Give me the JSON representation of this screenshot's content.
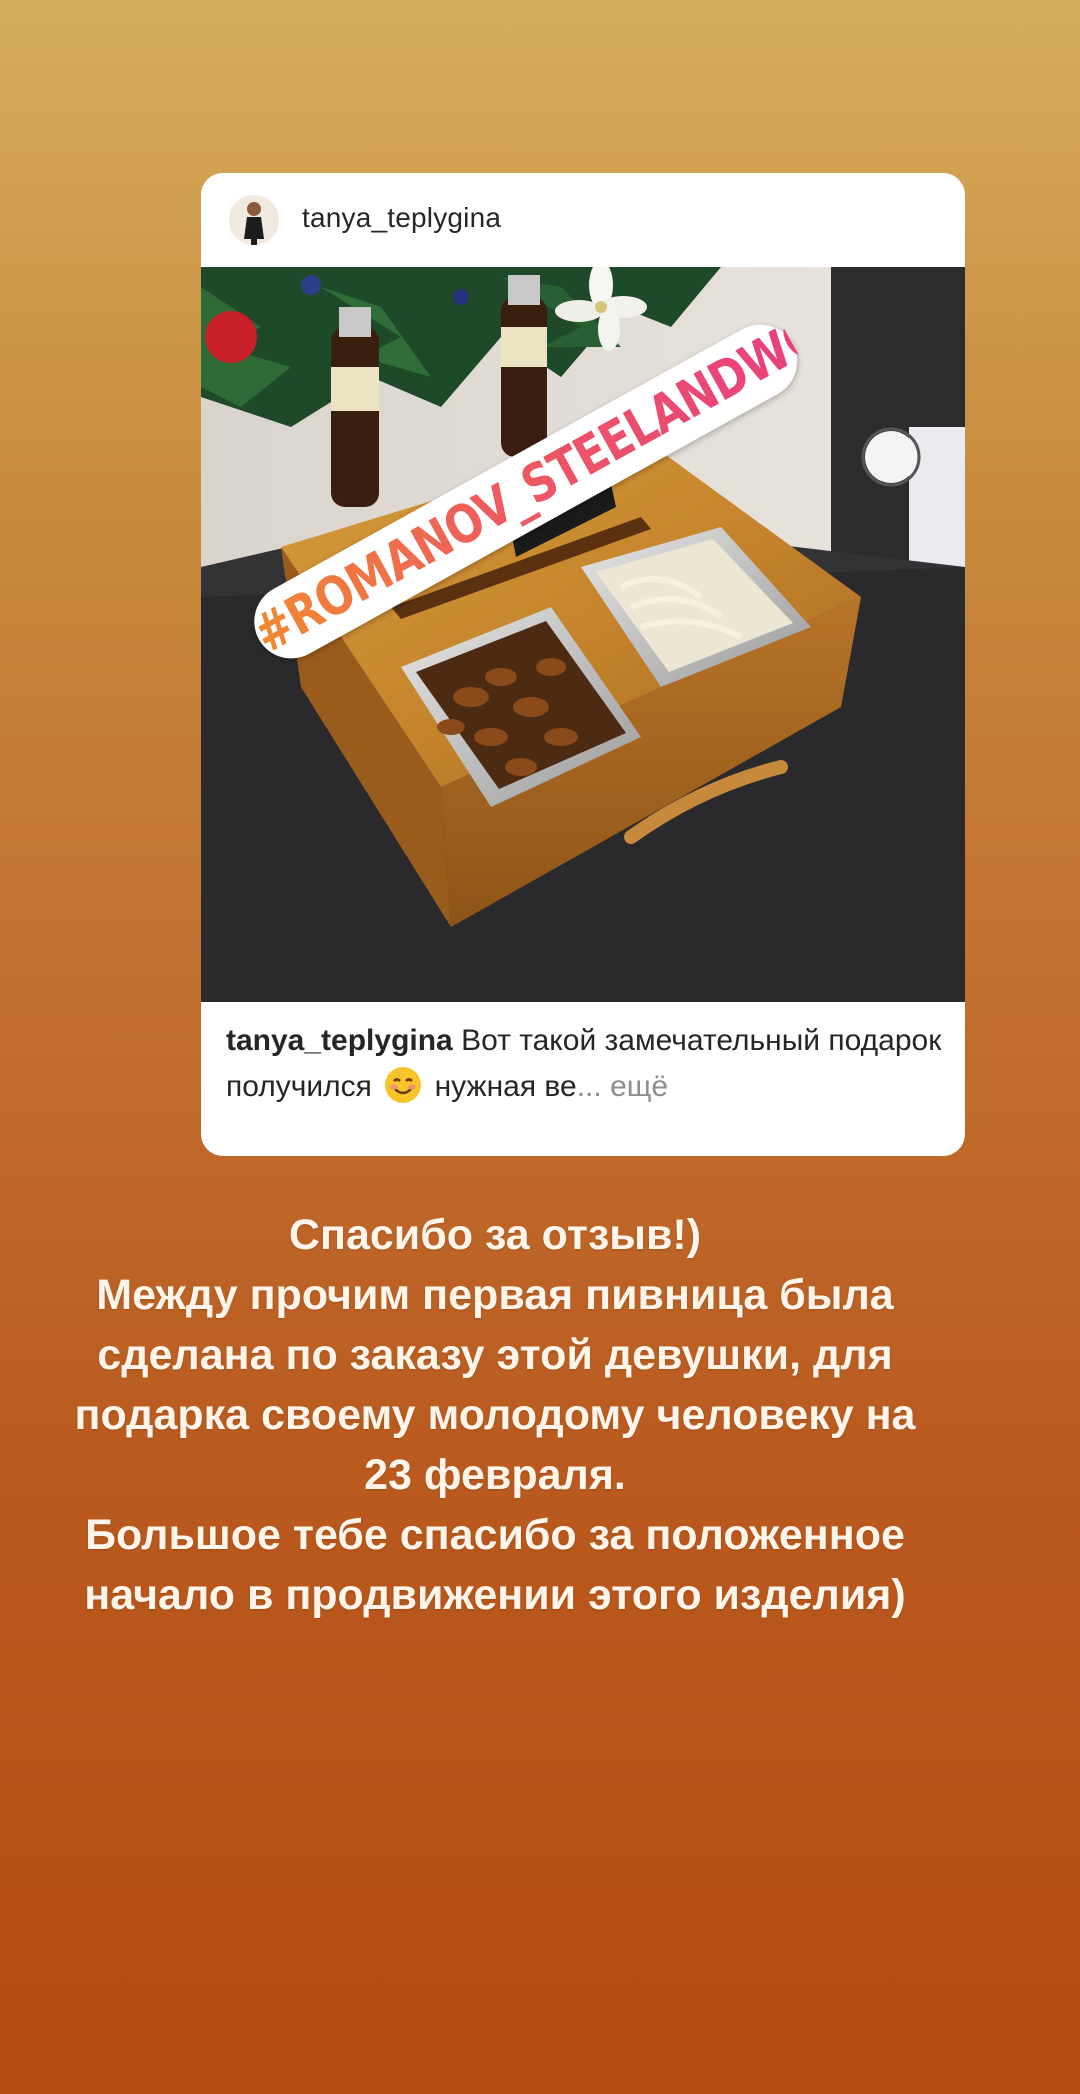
{
  "post": {
    "username": "tanya_teplygina",
    "hashtag_sticker": "#ROMANOV_STEELANDWOOD",
    "caption_username": "tanya_teplygina",
    "caption_part1": "Вот такой замечательный подарок получился",
    "caption_emoji": "smiling-face-icon",
    "caption_part2": "нужная ве",
    "caption_ellipsis": "...",
    "caption_more": "ещё"
  },
  "story_text": {
    "lines": [
      "Спасибо за отзыв!)",
      "Между прочим первая пивница была",
      "сделана по заказу этой девушки, для",
      "подарка своему молодому человеку на",
      "23 февраля.",
      "Большое тебе спасибо за положенное",
      "начало в продвижении этого изделия)"
    ]
  },
  "colors": {
    "background_top": "#d4ad5c",
    "background_bottom": "#b44c10",
    "hashtag_gradient_start": "#f08a30",
    "hashtag_gradient_end": "#e8407c",
    "story_text": "#fff5ea"
  }
}
